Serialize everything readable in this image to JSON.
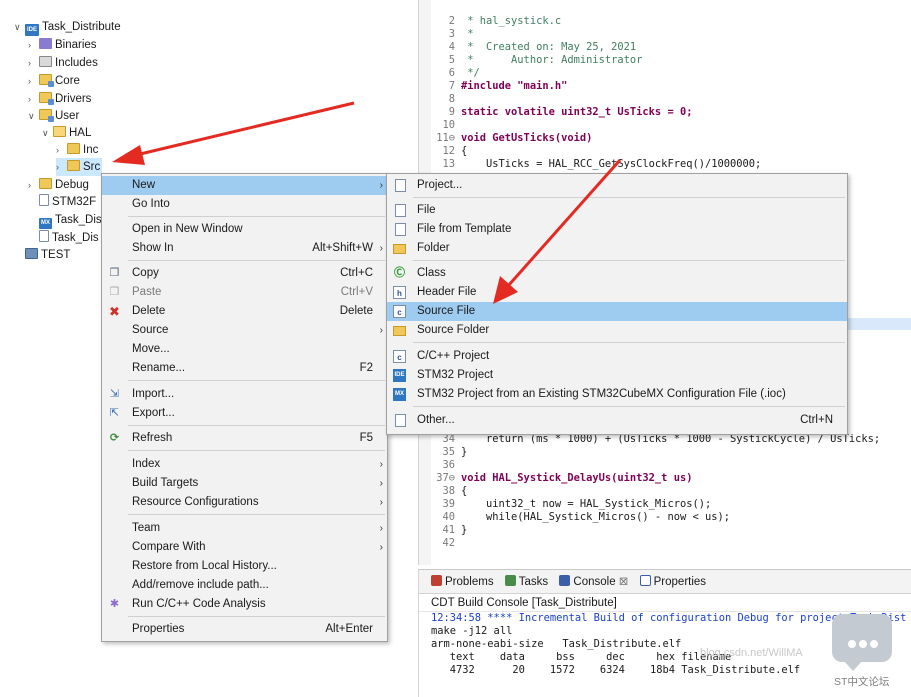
{
  "explorer": {
    "rows": [
      {
        "label": "Task_Distribute",
        "twisty": "∨",
        "icon": "project-icon"
      },
      {
        "label": "Binaries",
        "twisty": "›",
        "icon": "binaries-icon"
      },
      {
        "label": "Includes",
        "twisty": "›",
        "icon": "includes-icon"
      },
      {
        "label": "Core",
        "twisty": "›",
        "icon": "source-folder-icon"
      },
      {
        "label": "Drivers",
        "twisty": "›",
        "icon": "source-folder-icon"
      },
      {
        "label": "User",
        "twisty": "∨",
        "icon": "source-folder-icon"
      },
      {
        "label": "HAL",
        "twisty": "∨",
        "icon": "folder-open-icon"
      },
      {
        "label": "Inc",
        "twisty": "›",
        "icon": "folder-icon"
      },
      {
        "label": "Src",
        "twisty": "›",
        "icon": "folder-icon"
      },
      {
        "label": "Debug",
        "twisty": "›",
        "icon": "folder-icon"
      },
      {
        "label": "STM32F",
        "twisty": "",
        "icon": "file-icon"
      },
      {
        "label": "Task_Dis",
        "twisty": "",
        "icon": "mx-icon"
      },
      {
        "label": "Task_Dis",
        "twisty": "",
        "icon": "file-icon"
      },
      {
        "label": "TEST",
        "twisty": "",
        "icon": "test-project-icon"
      }
    ]
  },
  "editor": {
    "lines": [
      {
        "n": "2",
        "t": " * hal_systick.c"
      },
      {
        "n": "3",
        "t": " *"
      },
      {
        "n": "4",
        "t": " *  Created on: May 25, 2021"
      },
      {
        "n": "5",
        "t": " *      Author: Administrator"
      },
      {
        "n": "6",
        "t": " */"
      },
      {
        "n": "7",
        "t": "#include \"main.h\""
      },
      {
        "n": "8",
        "t": ""
      },
      {
        "n": "9",
        "t": "static volatile uint32_t UsTicks = 0;"
      },
      {
        "n": "10",
        "t": ""
      },
      {
        "n": "11⊖",
        "t": "void GetUsTicks(void)"
      },
      {
        "n": "12",
        "t": "{"
      },
      {
        "n": "13",
        "t": "    UsTicks = HAL_RCC_GetSysClockFreq()/1000000;"
      },
      {
        "n": "34",
        "t": "    return (ms * 1000) + (UsTicks * 1000 - SystickCycle) / UsTicks;"
      },
      {
        "n": "35",
        "t": "}"
      },
      {
        "n": "36",
        "t": ""
      },
      {
        "n": "37⊖",
        "t": "void HAL_Systick_DelayUs(uint32_t us)"
      },
      {
        "n": "38",
        "t": "{"
      },
      {
        "n": "39",
        "t": "    uint32_t now = HAL_Systick_Micros();"
      },
      {
        "n": "40",
        "t": "    while(HAL_Systick_Micros() - now < us);"
      },
      {
        "n": "41",
        "t": "}"
      },
      {
        "n": "42",
        "t": ""
      }
    ]
  },
  "console": {
    "tabs": [
      {
        "label": "Problems",
        "icon": "problems-icon"
      },
      {
        "label": "Tasks",
        "icon": "tasks-icon"
      },
      {
        "label": "Console",
        "icon": "console-icon"
      },
      {
        "label": "⊠",
        "icon": "close-icon"
      },
      {
        "label": "Properties",
        "icon": "properties-icon"
      }
    ],
    "title": "CDT Build Console [Task_Distribute]",
    "lines": [
      "12:34:58 **** Incremental Build of configuration Debug for project Task_Dist",
      "make -j12 all",
      "arm-none-eabi-size   Task_Distribute.elf",
      "   text    data     bss     dec     hex filename",
      "   4732      20    1572    6324    18b4 Task_Distribute.elf"
    ]
  },
  "context_menu": {
    "items": [
      {
        "label": "New",
        "accel": "",
        "submenu": true,
        "highlighted": true
      },
      {
        "label": "Go Into",
        "accel": ""
      },
      {
        "label": "Open in New Window",
        "accel": ""
      },
      {
        "label": "Show In",
        "accel": "Alt+Shift+W",
        "submenu": true
      },
      {
        "label": "Copy",
        "accel": "Ctrl+C",
        "icon": "copy-icon"
      },
      {
        "label": "Paste",
        "accel": "Ctrl+V",
        "icon": "paste-icon",
        "disabled": true
      },
      {
        "label": "Delete",
        "accel": "Delete",
        "icon": "delete-icon"
      },
      {
        "label": "Source",
        "accel": "",
        "submenu": true
      },
      {
        "label": "Move...",
        "accel": ""
      },
      {
        "label": "Rename...",
        "accel": "F2"
      },
      {
        "label": "Import...",
        "accel": "",
        "icon": "import-icon"
      },
      {
        "label": "Export...",
        "accel": "",
        "icon": "export-icon"
      },
      {
        "label": "Refresh",
        "accel": "F5",
        "icon": "refresh-icon"
      },
      {
        "label": "Index",
        "accel": "",
        "submenu": true
      },
      {
        "label": "Build Targets",
        "accel": "",
        "submenu": true
      },
      {
        "label": "Resource Configurations",
        "accel": "",
        "submenu": true
      },
      {
        "label": "Team",
        "accel": "",
        "submenu": true
      },
      {
        "label": "Compare With",
        "accel": "",
        "submenu": true
      },
      {
        "label": "Restore from Local History...",
        "accel": ""
      },
      {
        "label": "Add/remove include path...",
        "accel": ""
      },
      {
        "label": "Run C/C++ Code Analysis",
        "accel": "",
        "icon": "code-analysis-icon"
      },
      {
        "label": "Properties",
        "accel": "Alt+Enter"
      }
    ]
  },
  "submenu": {
    "items": [
      {
        "label": "Project...",
        "accel": ""
      },
      {
        "label": "File",
        "accel": ""
      },
      {
        "label": "File from Template",
        "accel": ""
      },
      {
        "label": "Folder",
        "accel": ""
      },
      {
        "label": "Class",
        "accel": ""
      },
      {
        "label": "Header File",
        "accel": ""
      },
      {
        "label": "Source File",
        "accel": "",
        "highlighted": true
      },
      {
        "label": "Source Folder",
        "accel": ""
      },
      {
        "label": "C/C++ Project",
        "accel": ""
      },
      {
        "label": "STM32 Project",
        "accel": ""
      },
      {
        "label": "STM32 Project from an Existing STM32CubeMX Configuration File (.ioc)",
        "accel": ""
      },
      {
        "label": "Other...",
        "accel": "Ctrl+N"
      }
    ]
  },
  "watermark": {
    "url_text": "blog.csdn.net/WillMA",
    "forum_label": "ST中文论坛"
  },
  "colors": {
    "menu_highlight": "#9ecbf0",
    "selection": "#cce8ff",
    "arrow": "#e32b22"
  }
}
